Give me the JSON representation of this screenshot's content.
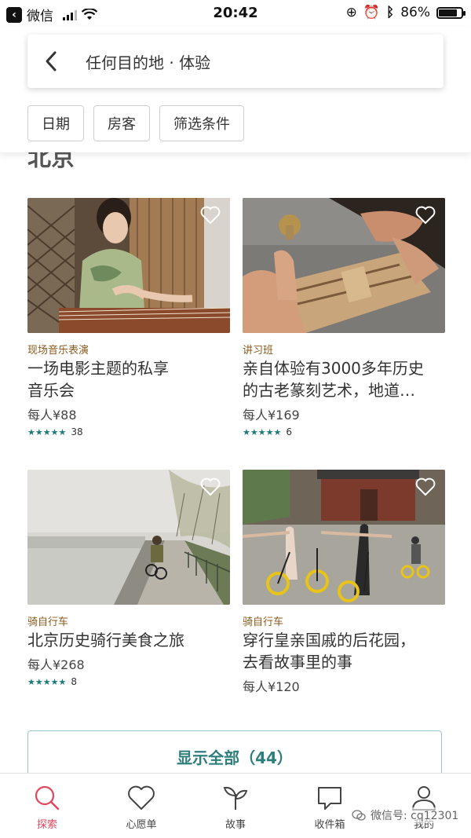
{
  "status_bar": {
    "carrier": "微信",
    "time": "20:42",
    "battery": "86%"
  },
  "search": {
    "title": "任何目的地 · 体验"
  },
  "filters": [
    "日期",
    "房客",
    "筛选条件"
  ],
  "section": {
    "title": "北京"
  },
  "listings": [
    {
      "category": "现场音乐表演",
      "title_line1": "一场电影主题的私享",
      "title_line2": "音乐会",
      "price": "每人¥88",
      "stars": "★★★★★",
      "reviews": "38"
    },
    {
      "category": "讲习班",
      "title_line1": "亲自体验有3000多年历史",
      "title_line2": "的古老篆刻艺术，地道…",
      "price": "每人¥169",
      "stars": "★★★★★",
      "reviews": "6"
    },
    {
      "category": "骑自行车",
      "title_line1": "北京历史骑行美食之旅",
      "title_line2": "",
      "price": "每人¥268",
      "stars": "★★★★★",
      "reviews": "8"
    },
    {
      "category": "骑自行车",
      "title_line1": "穿行皇亲国戚的后花园，",
      "title_line2": "去看故事里的事",
      "price": "每人¥120",
      "stars": "",
      "reviews": ""
    }
  ],
  "show_all": "显示全部（44）",
  "tabs": [
    {
      "label": "探索",
      "icon": "search-icon",
      "active": true
    },
    {
      "label": "心愿单",
      "icon": "heart-icon",
      "active": false
    },
    {
      "label": "故事",
      "icon": "sprout-icon",
      "active": false
    },
    {
      "label": "收件箱",
      "icon": "chat-bubble-icon",
      "active": false
    },
    {
      "label": "我的",
      "icon": "profile-icon",
      "active": false
    }
  ],
  "watermark": "微信号: cq12301",
  "colors": {
    "accent_active": "#e0465c",
    "teal": "#2e7f7c",
    "category": "#8a5a1e"
  }
}
